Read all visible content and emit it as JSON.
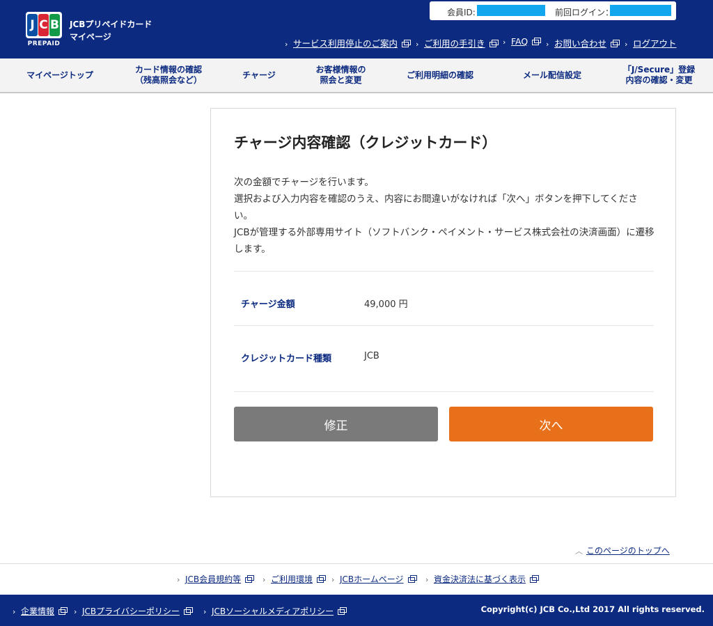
{
  "brand": {
    "logo_letters": [
      "J",
      "C",
      "B"
    ],
    "logo_sub": "PREPAID",
    "line1": "JCBプリペイドカード",
    "line2": "マイページ"
  },
  "login": {
    "member_id_label": "会員ID:",
    "last_login_label": "前回ログイン："
  },
  "util_nav": [
    {
      "label": "サービス利用停止のご案内"
    },
    {
      "label": "ご利用の手引き"
    },
    {
      "label": "FAQ"
    },
    {
      "label": "お問い合わせ"
    },
    {
      "label": "ログアウト"
    }
  ],
  "global_nav": [
    {
      "label": "マイページトップ"
    },
    {
      "label": "カード情報の確認\n（残高照会など）"
    },
    {
      "label": "チャージ"
    },
    {
      "label": "お客様情報の\n照会と変更"
    },
    {
      "label": "ご利用明細の確認"
    },
    {
      "label": "メール配信設定"
    },
    {
      "label": "「J/Secure」登録\n内容の確認・変更"
    }
  ],
  "main": {
    "title": "チャージ内容確認（クレジットカード）",
    "description": "次の金額でチャージを行います。\n選択および入力内容を確認のうえ、内容にお間違いがなければ「次へ」ボタンを押下してください。\nJCBが管理する外部専用サイト（ソフトバンク・ペイメント・サービス株式会社の決済画面）に遷移します。",
    "rows": [
      {
        "label": "チャージ金額",
        "value": "49,000 円"
      },
      {
        "label": "クレジットカード種類",
        "value": "JCB"
      }
    ],
    "back_button": "修正",
    "next_button": "次へ"
  },
  "page_top": "このページのトップへ",
  "footer_links": [
    {
      "label": "JCB会員規約等"
    },
    {
      "label": "ご利用環境"
    },
    {
      "label": "JCBホームページ"
    },
    {
      "label": "資金決済法に基づく表示"
    }
  ],
  "footer_bar_links": [
    {
      "label": "企業情報"
    },
    {
      "label": "JCBプライバシーポリシー"
    },
    {
      "label": "JCBソーシャルメディアポリシー"
    }
  ],
  "copyright": "Copyright(c) JCB Co.,Ltd 2017 All rights reserved.",
  "colors": {
    "header_bg": "#0b2a80",
    "mask": "#12a6ee",
    "next_button": "#e8701a",
    "back_button": "#7a7a7a",
    "label_blue": "#0b2a80"
  }
}
